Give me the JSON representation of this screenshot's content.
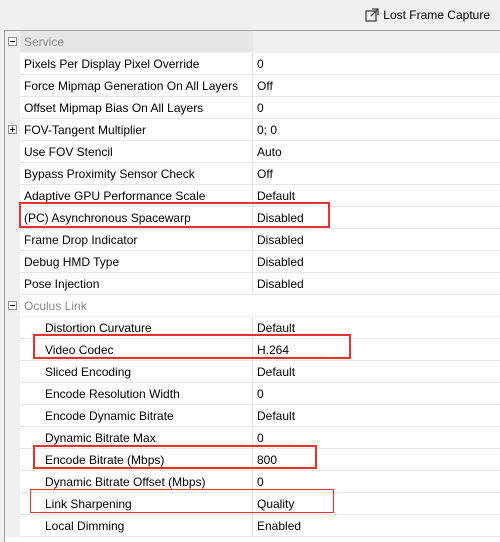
{
  "toolbar": {
    "lost_frame_capture_label": "Lost Frame Capture",
    "icon": "external-link-icon"
  },
  "categories": {
    "service": "Service",
    "oculus_link": "Oculus Link"
  },
  "service_rows": [
    {
      "name": "Pixels Per Display Pixel Override",
      "value": "0"
    },
    {
      "name": "Force Mipmap Generation On All Layers",
      "value": "Off"
    },
    {
      "name": "Offset Mipmap Bias On All Layers",
      "value": "0"
    },
    {
      "name": "FOV-Tangent Multiplier",
      "value": "0; 0"
    },
    {
      "name": "Use FOV Stencil",
      "value": "Auto"
    },
    {
      "name": "Bypass Proximity Sensor Check",
      "value": "Off"
    },
    {
      "name": "Adaptive GPU Performance Scale",
      "value": "Default"
    },
    {
      "name": "(PC) Asynchronous Spacewarp",
      "value": "Disabled"
    },
    {
      "name": "Frame Drop Indicator",
      "value": "Disabled"
    },
    {
      "name": "Debug HMD Type",
      "value": "Disabled"
    },
    {
      "name": "Pose Injection",
      "value": "Disabled"
    }
  ],
  "link_rows": [
    {
      "name": "Distortion Curvature",
      "value": "Default"
    },
    {
      "name": "Video Codec",
      "value": "H.264"
    },
    {
      "name": "Sliced Encoding",
      "value": "Default"
    },
    {
      "name": "Encode Resolution Width",
      "value": "0"
    },
    {
      "name": "Encode Dynamic Bitrate",
      "value": "Default"
    },
    {
      "name": "Dynamic Bitrate Max",
      "value": "0"
    },
    {
      "name": "Encode Bitrate (Mbps)",
      "value": "800"
    },
    {
      "name": "Dynamic Bitrate Offset (Mbps)",
      "value": "0"
    },
    {
      "name": "Link Sharpening",
      "value": "Quality"
    },
    {
      "name": "Local Dimming",
      "value": "Enabled"
    }
  ],
  "highlight_color": "#e33333"
}
